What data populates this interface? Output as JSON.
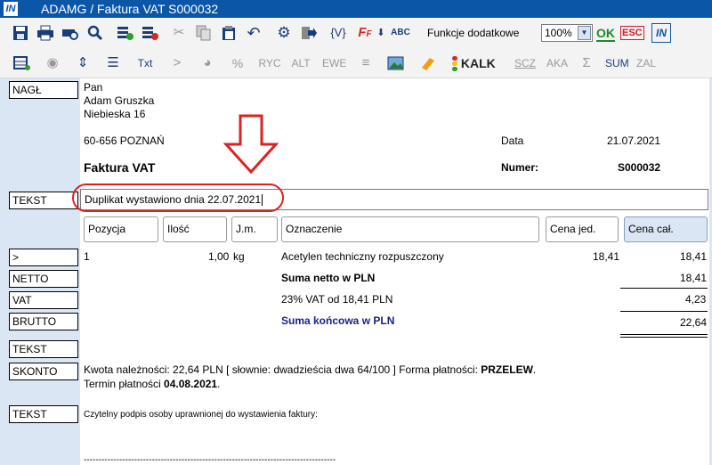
{
  "window": {
    "title": "ADAMG / Faktura VAT S000032",
    "app_icon": "app-logo-icon"
  },
  "toolbar1": {
    "icons": [
      "save-icon",
      "print-icon",
      "print-preview-icon",
      "search-icon",
      "add-row-icon",
      "delete-row-icon",
      "cut-icon",
      "copy-icon",
      "paste-icon",
      "undo-icon",
      "settings-gear-icon",
      "export-icon",
      "variables-icon",
      "font-format-icon",
      "spellcheck-icon"
    ],
    "variables_label": "{V}",
    "extra_functions_label": "Funkcje dodatkowe",
    "zoom_value": "100%",
    "ok_label": "OK",
    "esc_label": "ESC",
    "help_label": "IN"
  },
  "toolbar2": {
    "txt_label": "Txt",
    "greater_label": ">",
    "percent_label": "%",
    "ryc_label": "RYC",
    "alt_label": "ALT",
    "ewe_label": "EWE",
    "kalk_label": "KALK",
    "scz_label": "SCZ",
    "aka_label": "AKA",
    "sum_label": "SUM",
    "zal_label": "ZAL"
  },
  "row_labels": {
    "nagl": "NAGŁ",
    "tekst1": "TEKST",
    "pos": ">",
    "netto": "NETTO",
    "vat": "VAT",
    "brutto": "BRUTTO",
    "tekst2": "TEKST",
    "skonto": "SKONTO",
    "tekst3": "TEKST"
  },
  "header": {
    "salutation": "Pan",
    "name": "Adam Gruszka",
    "street": "Niebieska 16",
    "city": "60-656 POZNAŃ",
    "date_label": "Data",
    "date_value": "21.07.2021",
    "doc_title": "Faktura VAT",
    "number_label": "Numer:",
    "number_value": "S000032"
  },
  "tekst_field": {
    "value": "Duplikat wystawiono dnia 22.07.2021"
  },
  "annotation": {
    "color": "#e02020",
    "arrow_icon": "down-arrow-icon"
  },
  "table": {
    "headers": {
      "pos": "Pozycja",
      "qty": "Ilość",
      "unit": "J.m.",
      "name": "Oznaczenie",
      "unit_price": "Cena jed.",
      "total_price": "Cena cał."
    },
    "rows": [
      {
        "pos": "1",
        "qty": "1,00",
        "unit": "kg",
        "name": "Acetylen techniczny rozpuszczony",
        "unit_price": "18,41",
        "total_price": "18,41"
      }
    ]
  },
  "summary": {
    "netto_label": "Suma netto w PLN",
    "netto_value": "18,41",
    "vat_label": "23% VAT od 18,41 PLN",
    "vat_value": "4,23",
    "brutto_label": "Suma końcowa w PLN",
    "brutto_value": "22,64"
  },
  "skonto": {
    "line1_prefix": "Kwota należności: 22,64 PLN [ słownie: dwadzieścia dwa 64/100 ] Forma płatności: ",
    "payment_method": "PRZELEW",
    "line1_suffix": ".",
    "line2_prefix": "Termin płatności ",
    "due_date": "04.08.2021",
    "line2_suffix": "."
  },
  "signature": {
    "text": "Czytelny podpis osoby uprawnionej do wystawienia faktury:",
    "line": "-------------------------------------------------------------------------------------"
  },
  "colors": {
    "titlebar": "#0b56a6",
    "leftcol": "#dbe6f4",
    "accent_navy": "#1a237e"
  }
}
